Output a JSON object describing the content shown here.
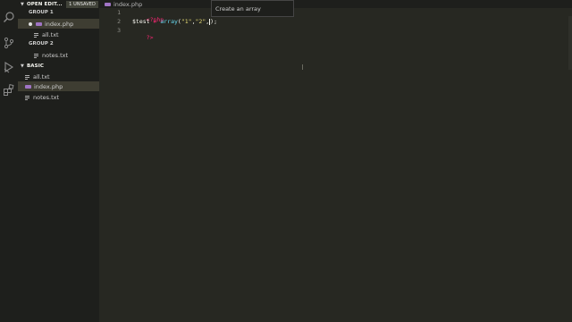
{
  "sidebar": {
    "open_editors": {
      "title": "OPEN EDIT...",
      "badge": "1 UNSAVED",
      "groups": [
        {
          "label": "GROUP 1",
          "files": [
            {
              "name": "index.php",
              "type": "php",
              "dirty": true
            }
          ]
        },
        {
          "label": "GROUP 2",
          "files": [
            {
              "name": "notes.txt",
              "type": "txt"
            }
          ]
        }
      ],
      "group1_extra": {
        "name": "all.txt",
        "type": "txt"
      }
    },
    "basic": {
      "title": "BASIC",
      "files": [
        {
          "name": "all.txt",
          "type": "txt"
        },
        {
          "name": "index.php",
          "type": "php",
          "selected": true
        },
        {
          "name": "notes.txt",
          "type": "txt"
        }
      ]
    }
  },
  "tabs": {
    "active": "index.php"
  },
  "editor": {
    "line_numbers": [
      "1",
      "2",
      "3"
    ],
    "line1": "<?php",
    "line2": {
      "var": "$test",
      "op": " = ",
      "fn": "array",
      "open": "(",
      "s1": "\"1\"",
      "comma1": ",",
      "s2": "\"2\"",
      "comma2": ",",
      "close": ");"
    },
    "line3": "?>"
  },
  "tooltip": {
    "text": "Create an array"
  },
  "icons": {
    "activity_bar": [
      "search-icon",
      "source-control-icon",
      "debug-icon",
      "extensions-icon"
    ]
  }
}
